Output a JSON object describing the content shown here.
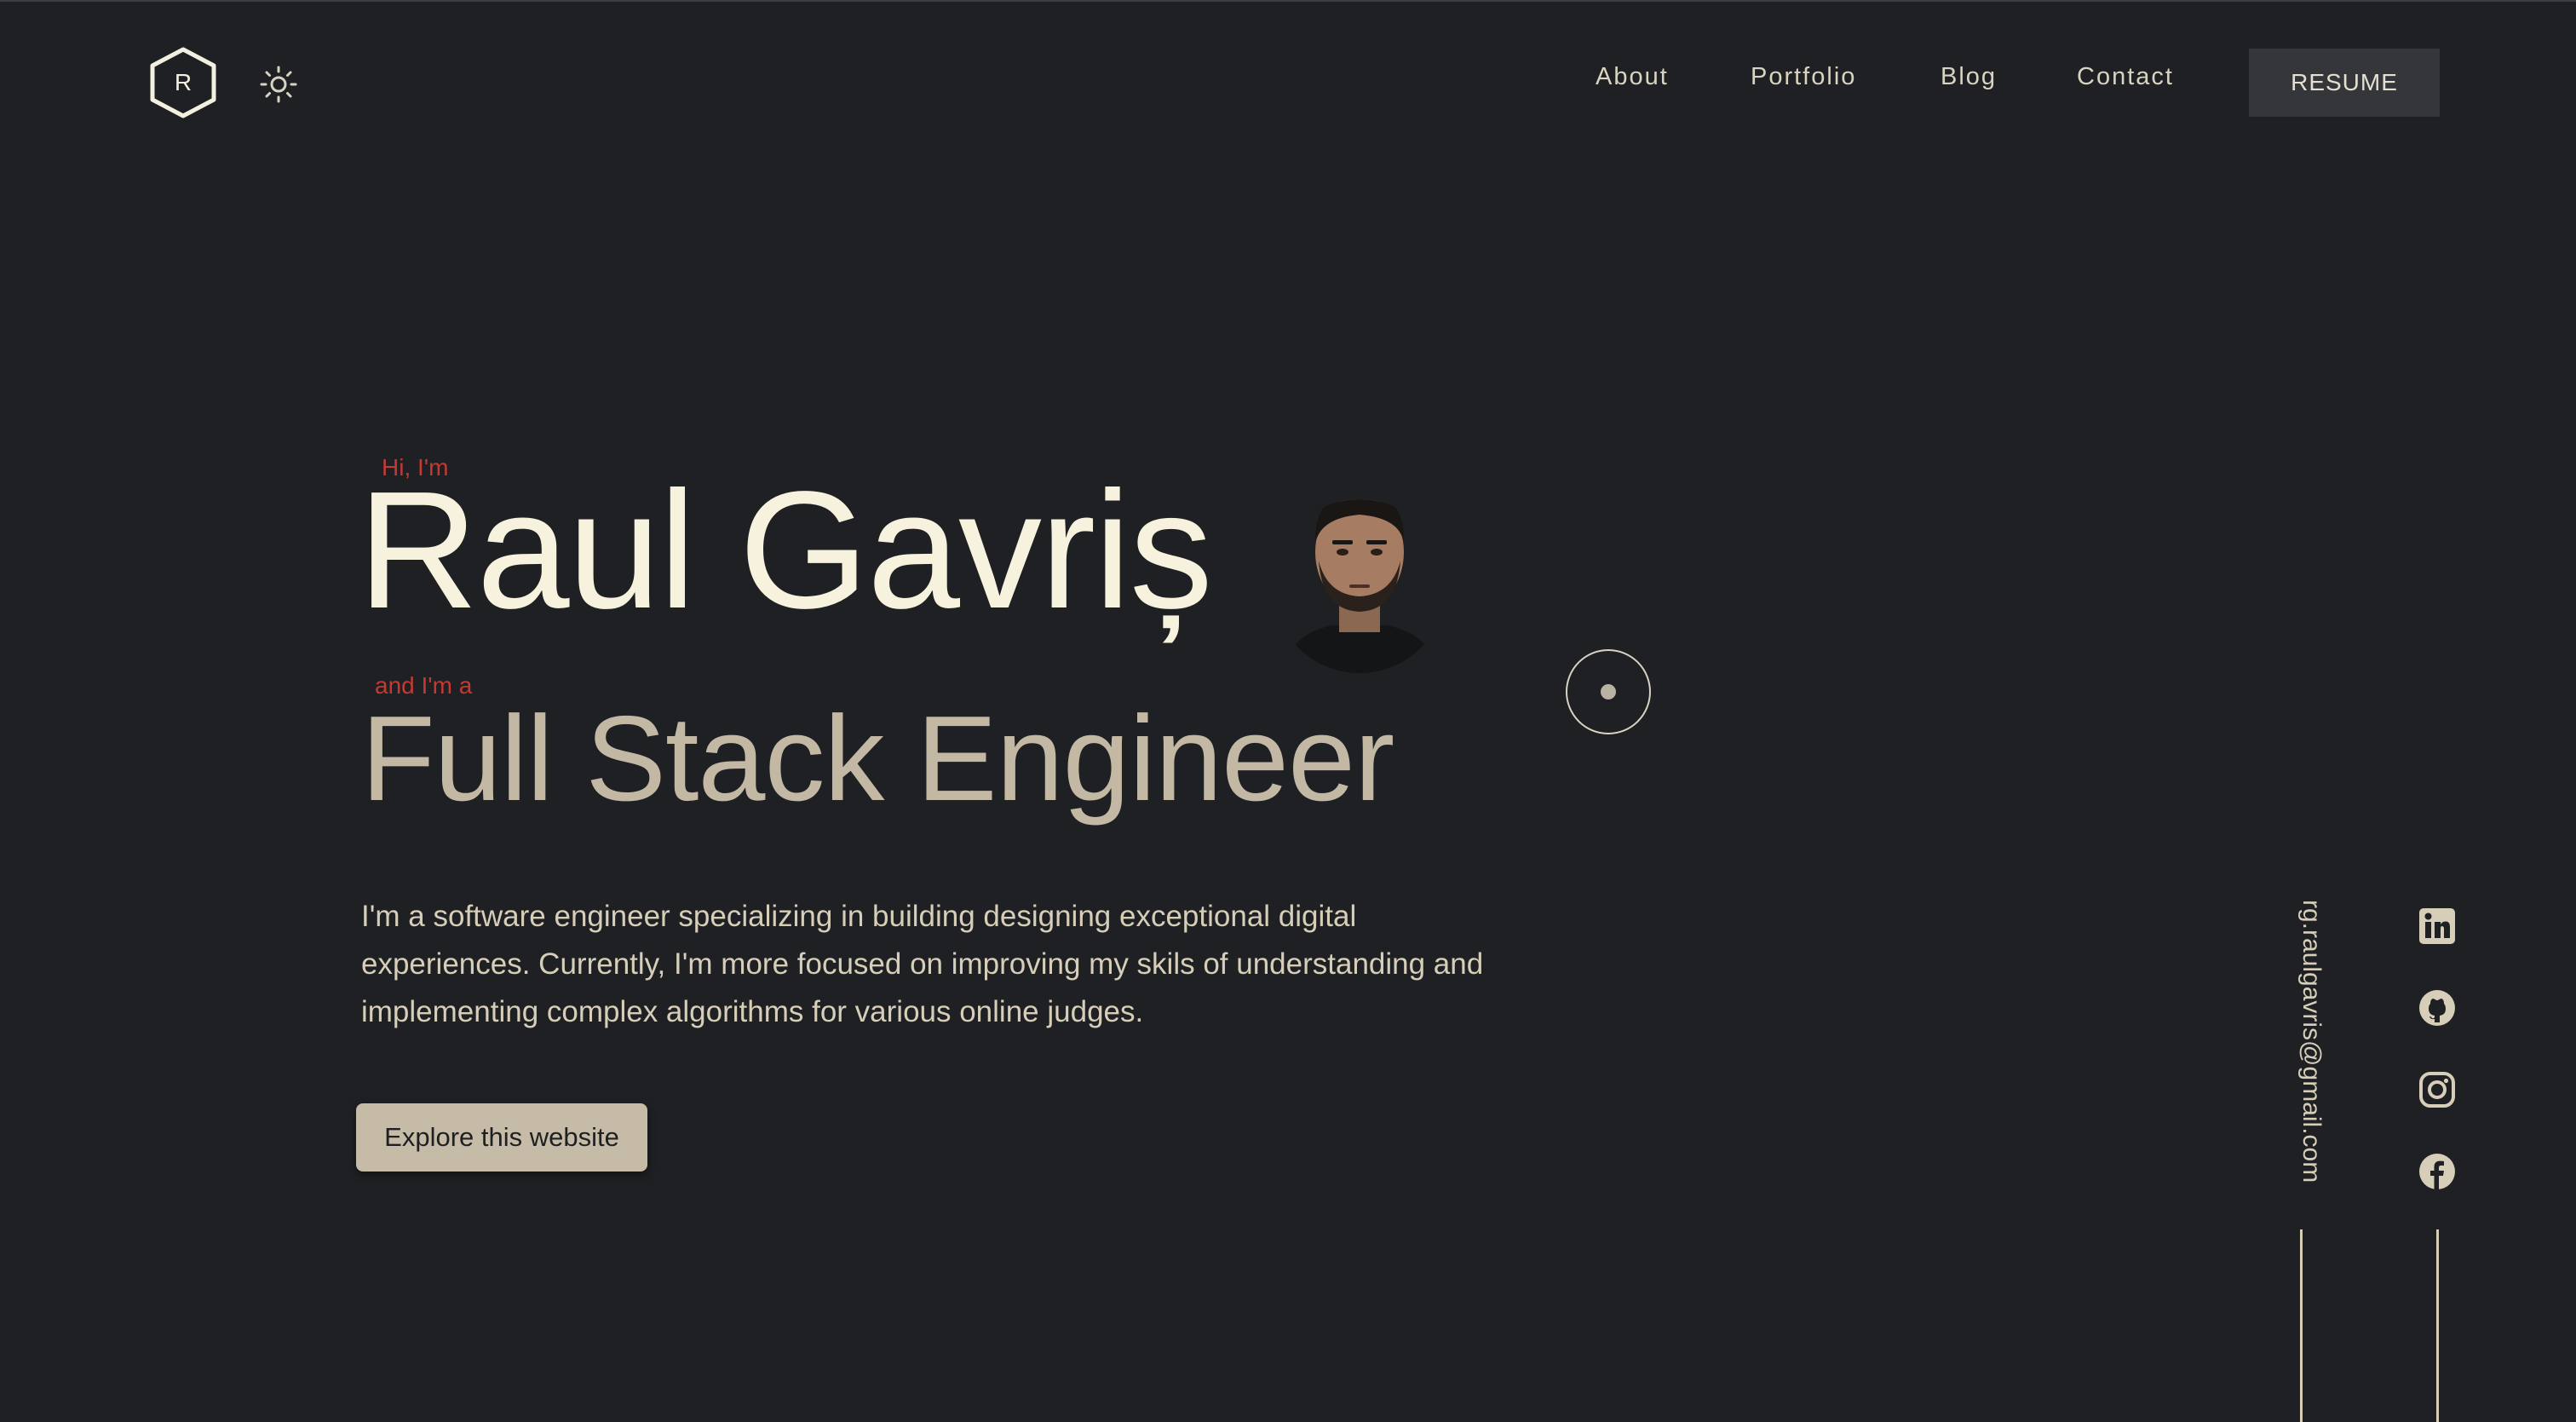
{
  "header": {
    "logo_letter": "R",
    "nav": {
      "about": "About",
      "portfolio": "Portfolio",
      "blog": "Blog",
      "contact": "Contact"
    },
    "resume_label": "RESUME",
    "icons": {
      "logo": "hexagon-logo-icon",
      "theme": "sun-icon"
    }
  },
  "hero": {
    "intro_hi": "Hi, I'm",
    "name": "Raul Gavriș",
    "intro_and": "and I'm a",
    "role": "Full Stack Engineer",
    "description": "I'm a software engineer specializing in building designing exceptional digital experiences. Currently, I'm more focused on improving my skils of understanding and implementing complex algorithms for various online judges.",
    "cta_label": "Explore this website"
  },
  "sidebar": {
    "email": "rg.raulgavris@gmail.com",
    "socials": [
      "linkedin-icon",
      "github-icon",
      "instagram-icon",
      "facebook-icon"
    ]
  },
  "colors": {
    "background": "#1f2023",
    "name_text": "#f6f2de",
    "role_text": "#c2b8a4",
    "accent_red": "#c23a32",
    "button_bg": "#c6bba6",
    "resume_bg": "#34363a"
  }
}
